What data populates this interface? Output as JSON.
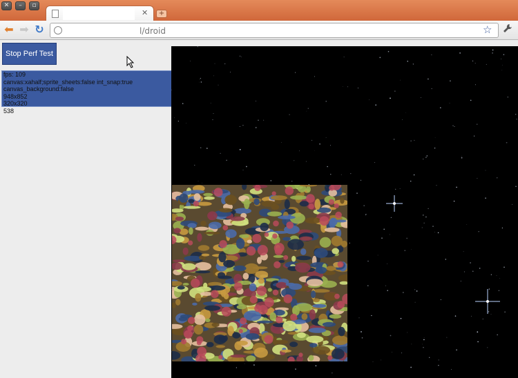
{
  "window": {
    "controls": [
      "close-icon",
      "minimize-icon",
      "maximize-icon"
    ],
    "control_glyphs": {
      "close": "✕",
      "minimize": "–",
      "maximize": "▫"
    }
  },
  "tab": {
    "close_glyph": "✕",
    "new_tab_glyph": "+"
  },
  "toolbar": {
    "back_glyph": "⬅",
    "forward_glyph": "➡",
    "reload_glyph": "↻",
    "url_visible": "l/droid",
    "star_glyph": "☆",
    "wrench_glyph": "🔧"
  },
  "page": {
    "button_label": "Stop Perf Test",
    "stats": [
      "fps: 109",
      "canvas:xahalf;sprite_sheets:false int_snap:true canvas_background:false",
      "948x852",
      "320x320",
      "538"
    ]
  },
  "colors": {
    "titlebar": "#d0673a",
    "button_bg": "#3b5aa0",
    "game_bg": "#000000",
    "back_arrow": "#e0802f",
    "reload": "#3c78c8"
  }
}
